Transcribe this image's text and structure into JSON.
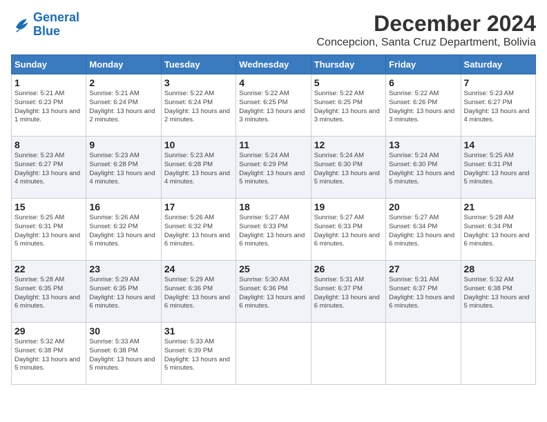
{
  "logo": {
    "line1": "General",
    "line2": "Blue"
  },
  "title": "December 2024",
  "location": "Concepcion, Santa Cruz Department, Bolivia",
  "days_of_week": [
    "Sunday",
    "Monday",
    "Tuesday",
    "Wednesday",
    "Thursday",
    "Friday",
    "Saturday"
  ],
  "weeks": [
    [
      {
        "day": "1",
        "sunrise": "Sunrise: 5:21 AM",
        "sunset": "Sunset: 6:23 PM",
        "daylight": "Daylight: 13 hours and 1 minute."
      },
      {
        "day": "2",
        "sunrise": "Sunrise: 5:21 AM",
        "sunset": "Sunset: 6:24 PM",
        "daylight": "Daylight: 13 hours and 2 minutes."
      },
      {
        "day": "3",
        "sunrise": "Sunrise: 5:22 AM",
        "sunset": "Sunset: 6:24 PM",
        "daylight": "Daylight: 13 hours and 2 minutes."
      },
      {
        "day": "4",
        "sunrise": "Sunrise: 5:22 AM",
        "sunset": "Sunset: 6:25 PM",
        "daylight": "Daylight: 13 hours and 3 minutes."
      },
      {
        "day": "5",
        "sunrise": "Sunrise: 5:22 AM",
        "sunset": "Sunset: 6:25 PM",
        "daylight": "Daylight: 13 hours and 3 minutes."
      },
      {
        "day": "6",
        "sunrise": "Sunrise: 5:22 AM",
        "sunset": "Sunset: 6:26 PM",
        "daylight": "Daylight: 13 hours and 3 minutes."
      },
      {
        "day": "7",
        "sunrise": "Sunrise: 5:23 AM",
        "sunset": "Sunset: 6:27 PM",
        "daylight": "Daylight: 13 hours and 4 minutes."
      }
    ],
    [
      {
        "day": "8",
        "sunrise": "Sunrise: 5:23 AM",
        "sunset": "Sunset: 6:27 PM",
        "daylight": "Daylight: 13 hours and 4 minutes."
      },
      {
        "day": "9",
        "sunrise": "Sunrise: 5:23 AM",
        "sunset": "Sunset: 6:28 PM",
        "daylight": "Daylight: 13 hours and 4 minutes."
      },
      {
        "day": "10",
        "sunrise": "Sunrise: 5:23 AM",
        "sunset": "Sunset: 6:28 PM",
        "daylight": "Daylight: 13 hours and 4 minutes."
      },
      {
        "day": "11",
        "sunrise": "Sunrise: 5:24 AM",
        "sunset": "Sunset: 6:29 PM",
        "daylight": "Daylight: 13 hours and 5 minutes."
      },
      {
        "day": "12",
        "sunrise": "Sunrise: 5:24 AM",
        "sunset": "Sunset: 6:30 PM",
        "daylight": "Daylight: 13 hours and 5 minutes."
      },
      {
        "day": "13",
        "sunrise": "Sunrise: 5:24 AM",
        "sunset": "Sunset: 6:30 PM",
        "daylight": "Daylight: 13 hours and 5 minutes."
      },
      {
        "day": "14",
        "sunrise": "Sunrise: 5:25 AM",
        "sunset": "Sunset: 6:31 PM",
        "daylight": "Daylight: 13 hours and 5 minutes."
      }
    ],
    [
      {
        "day": "15",
        "sunrise": "Sunrise: 5:25 AM",
        "sunset": "Sunset: 6:31 PM",
        "daylight": "Daylight: 13 hours and 5 minutes."
      },
      {
        "day": "16",
        "sunrise": "Sunrise: 5:26 AM",
        "sunset": "Sunset: 6:32 PM",
        "daylight": "Daylight: 13 hours and 6 minutes."
      },
      {
        "day": "17",
        "sunrise": "Sunrise: 5:26 AM",
        "sunset": "Sunset: 6:32 PM",
        "daylight": "Daylight: 13 hours and 6 minutes."
      },
      {
        "day": "18",
        "sunrise": "Sunrise: 5:27 AM",
        "sunset": "Sunset: 6:33 PM",
        "daylight": "Daylight: 13 hours and 6 minutes."
      },
      {
        "day": "19",
        "sunrise": "Sunrise: 5:27 AM",
        "sunset": "Sunset: 6:33 PM",
        "daylight": "Daylight: 13 hours and 6 minutes."
      },
      {
        "day": "20",
        "sunrise": "Sunrise: 5:27 AM",
        "sunset": "Sunset: 6:34 PM",
        "daylight": "Daylight: 13 hours and 6 minutes."
      },
      {
        "day": "21",
        "sunrise": "Sunrise: 5:28 AM",
        "sunset": "Sunset: 6:34 PM",
        "daylight": "Daylight: 13 hours and 6 minutes."
      }
    ],
    [
      {
        "day": "22",
        "sunrise": "Sunrise: 5:28 AM",
        "sunset": "Sunset: 6:35 PM",
        "daylight": "Daylight: 13 hours and 6 minutes."
      },
      {
        "day": "23",
        "sunrise": "Sunrise: 5:29 AM",
        "sunset": "Sunset: 6:35 PM",
        "daylight": "Daylight: 13 hours and 6 minutes."
      },
      {
        "day": "24",
        "sunrise": "Sunrise: 5:29 AM",
        "sunset": "Sunset: 6:36 PM",
        "daylight": "Daylight: 13 hours and 6 minutes."
      },
      {
        "day": "25",
        "sunrise": "Sunrise: 5:30 AM",
        "sunset": "Sunset: 6:36 PM",
        "daylight": "Daylight: 13 hours and 6 minutes."
      },
      {
        "day": "26",
        "sunrise": "Sunrise: 5:31 AM",
        "sunset": "Sunset: 6:37 PM",
        "daylight": "Daylight: 13 hours and 6 minutes."
      },
      {
        "day": "27",
        "sunrise": "Sunrise: 5:31 AM",
        "sunset": "Sunset: 6:37 PM",
        "daylight": "Daylight: 13 hours and 6 minutes."
      },
      {
        "day": "28",
        "sunrise": "Sunrise: 5:32 AM",
        "sunset": "Sunset: 6:38 PM",
        "daylight": "Daylight: 13 hours and 5 minutes."
      }
    ],
    [
      {
        "day": "29",
        "sunrise": "Sunrise: 5:32 AM",
        "sunset": "Sunset: 6:38 PM",
        "daylight": "Daylight: 13 hours and 5 minutes."
      },
      {
        "day": "30",
        "sunrise": "Sunrise: 5:33 AM",
        "sunset": "Sunset: 6:38 PM",
        "daylight": "Daylight: 13 hours and 5 minutes."
      },
      {
        "day": "31",
        "sunrise": "Sunrise: 5:33 AM",
        "sunset": "Sunset: 6:39 PM",
        "daylight": "Daylight: 13 hours and 5 minutes."
      },
      {
        "day": "",
        "sunrise": "",
        "sunset": "",
        "daylight": ""
      },
      {
        "day": "",
        "sunrise": "",
        "sunset": "",
        "daylight": ""
      },
      {
        "day": "",
        "sunrise": "",
        "sunset": "",
        "daylight": ""
      },
      {
        "day": "",
        "sunrise": "",
        "sunset": "",
        "daylight": ""
      }
    ]
  ]
}
